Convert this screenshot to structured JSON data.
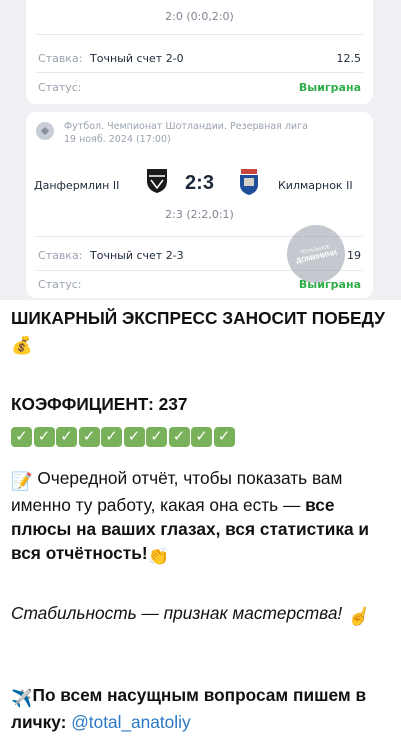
{
  "screenshot": {
    "card1": {
      "score_detail": "2:0 (0:0,2:0)",
      "bet_label": "Ставка:",
      "bet_value": "Точный счет 2-0",
      "odds": "12.5",
      "status_label": "Статус:",
      "status_value": "Выиграна"
    },
    "card2": {
      "league": "Футбол. Чемпионат Шотландии. Резервная лига",
      "date": "19 нояб. 2024 (17:00)",
      "home_team": "Данфермлин II",
      "away_team": "Килмарнок II",
      "score": "2:3",
      "score_detail": "2:3 (2:2,0:1)",
      "bet_label": "Ставка:",
      "bet_value": "Точный счет 2-3",
      "odds": "19",
      "status_label": "Статус:",
      "status_value": "Выиграна"
    },
    "watermark": "ДОМИНИНИ"
  },
  "message": {
    "headline": "ШИКАРНЫЙ ЭКСПРЕСС ЗАНОСИТ ПОБЕДУ",
    "headline_emoji": "💰",
    "coef": "КОЭФФИЦИЕНТ: 237",
    "checks_count": 10,
    "report_emoji": "📝",
    "report_text": " Очередной отчёт, чтобы показать вам именно ту работу, какая она есть — ",
    "report_bold": "все плюсы на ваших глазах, вся статистика и вся отчётность!",
    "clap_emoji": "👏",
    "stability": "Стабильность — признак мастерства!",
    "finger_emoji": "☝️",
    "plane_emoji": "✈️",
    "questions_bold": "По всем насущным вопросам пишем в личку:",
    "contact": "@total_anatoliy"
  },
  "colors": {
    "win": "#2fae4a",
    "link": "#2a78c5",
    "check": "#78b159"
  }
}
